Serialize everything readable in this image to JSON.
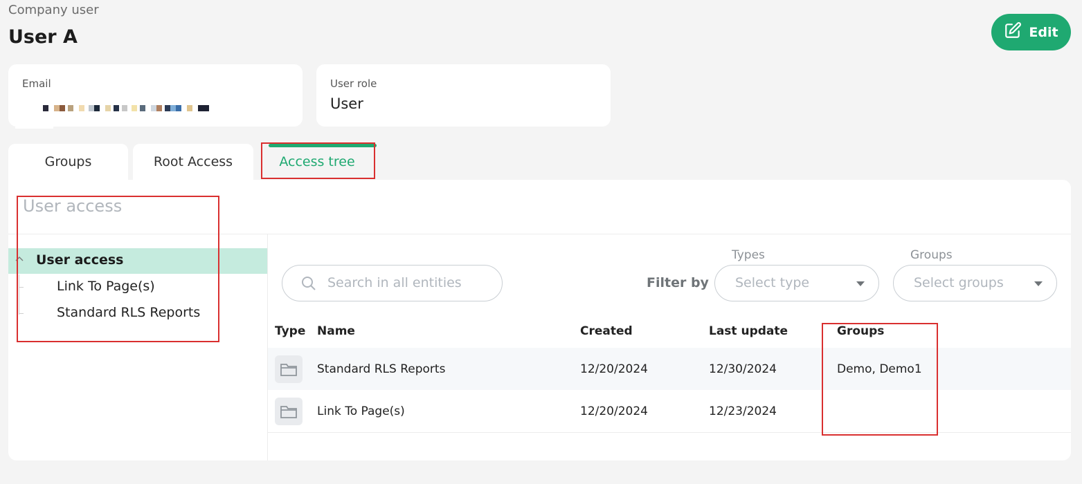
{
  "header": {
    "subtitle": "Company user",
    "title": "User A",
    "edit_label": "Edit"
  },
  "cards": {
    "email": {
      "label": "Email",
      "value": ""
    },
    "role": {
      "label": "User role",
      "value": "User"
    }
  },
  "tabs": [
    {
      "label": "Groups"
    },
    {
      "label": "Root Access"
    },
    {
      "label": "Access tree",
      "active": true
    }
  ],
  "panel": {
    "title": "User access"
  },
  "tree": {
    "root": "User access",
    "children": [
      "Link To Page(s)",
      "Standard RLS Reports"
    ]
  },
  "toolbar": {
    "search_placeholder": "Search in all entities",
    "filter_by": "Filter by",
    "types_label": "Types",
    "types_placeholder": "Select type",
    "groups_label": "Groups",
    "groups_placeholder": "Select groups"
  },
  "table": {
    "columns": [
      "Type",
      "Name",
      "Created",
      "Last update",
      "Groups"
    ],
    "rows": [
      {
        "name": "Standard RLS Reports",
        "created": "12/20/2024",
        "updated": "12/30/2024",
        "groups": "Demo, Demo1"
      },
      {
        "name": "Link To Page(s)",
        "created": "12/20/2024",
        "updated": "12/23/2024",
        "groups": ""
      }
    ]
  },
  "colors": {
    "accent": "#1fa971",
    "tree_selected": "#c5ebde",
    "highlight_box": "#d92f2f"
  },
  "icons": {
    "edit": "edit-icon",
    "search": "search-icon",
    "folder": "folder-icon",
    "caret": "caret-down-icon",
    "chevron": "chevron-up-icon"
  }
}
